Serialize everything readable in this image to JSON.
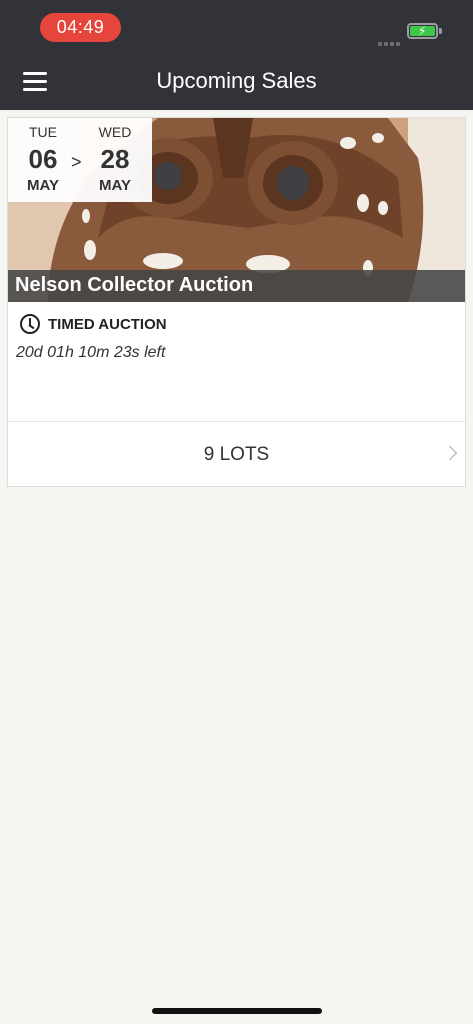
{
  "status_bar": {
    "time": "04:49",
    "time_pill_color": "#e5453a",
    "battery_color": "#3ec84a",
    "icons": [
      "signal-dots-icon",
      "battery-charging-icon"
    ]
  },
  "header": {
    "title": "Upcoming Sales",
    "menu_icon": "hamburger-menu-icon",
    "background_color": "#313338"
  },
  "sale": {
    "start": {
      "dow": "TUE",
      "day": "06",
      "month": "MAY"
    },
    "end": {
      "dow": "WED",
      "day": "28",
      "month": "MAY"
    },
    "range_separator": ">",
    "name": "Nelson Collector Auction",
    "type_icon": "clock-icon",
    "type": "TIMED AUCTION",
    "countdown": "20d 01h 10m 23s left",
    "lots_label": "9 LOTS",
    "lots_icon": "chevron-right-icon"
  }
}
